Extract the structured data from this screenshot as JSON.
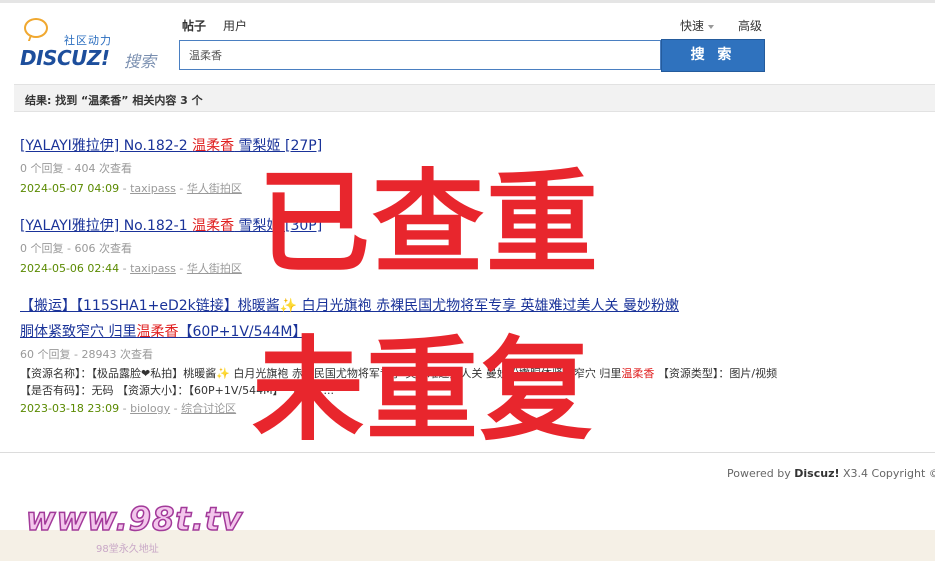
{
  "logo": {
    "subtitle": "社区动力",
    "brand": "DISCUZ!",
    "search_word": "搜索"
  },
  "tabs": {
    "post": "帖子",
    "user": "用户",
    "quick": "快速",
    "advanced": "高级"
  },
  "search": {
    "value": "温柔香",
    "button": "搜 索"
  },
  "result_summary": "结果: 找到 “温柔香” 相关内容 3 个",
  "results": [
    {
      "title_before": "[YALAYI雅拉伊] No.182-2 ",
      "highlight": "温柔香",
      "title_after": " 雪梨姬 [27P]",
      "meta": "0 个回复 - 404 次查看",
      "date": "2024-05-07 04:09",
      "author": "taxipass",
      "forum": "华人街拍区"
    },
    {
      "title_before": "[YALAYI雅拉伊] No.182-1 ",
      "highlight": "温柔香",
      "title_after": " 雪梨姬 [30P]",
      "meta": "0 个回复 - 606 次查看",
      "date": "2024-05-06 02:44",
      "author": "taxipass",
      "forum": "华人街拍区"
    },
    {
      "title_line1": "【搬运】【115SHA1+eD2k链接】桃暖酱✨ 白月光旗袍 赤裸民国尤物将军专享 英雄难过美人关 曼妙粉嫩",
      "title_line2_before": "胴体紧致窄穴 归里",
      "highlight": "温柔香",
      "title_line2_after": "【60P+1V/544M】",
      "meta": "60 个回复 - 28943 次查看",
      "summary_before": "【资源名称】：【极品露脸❤私拍】桃暖酱✨ 白月光旗袍 赤裸民国尤物将军专享 英雄难过美人关 曼妙粉嫩胴体紧致窄穴 归里",
      "summary_after": " 【资源类型】：图片/视频 【是否有码】：无码 【资源大小】：【60P+1V/544M】 【资源 ...",
      "date": "2023-03-18 23:09",
      "author": "biology",
      "forum": "综合讨论区"
    }
  ],
  "footer": {
    "powered_prefix": "Powered by ",
    "powered_brand": "Discuz!",
    "powered_suffix": " X3.4   Copyright ©"
  },
  "watermark": {
    "line1": "已查重",
    "line2": "未重复"
  },
  "site_watermark": {
    "url": "www.98t.tv",
    "sub": "98堂永久地址"
  }
}
